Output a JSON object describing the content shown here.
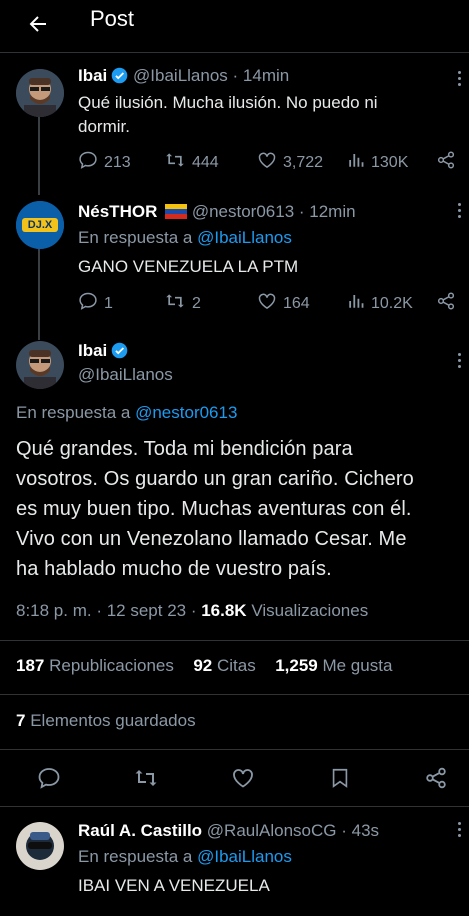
{
  "header": {
    "title": "Post"
  },
  "tweets": [
    {
      "name": "Ibai",
      "handle": "@IbaiLlanos",
      "time": "· 14min",
      "text_line1": "Qué ilusión. Mucha ilusión. No puedo ni",
      "text_line2": "dormir.",
      "replies": "213",
      "retweets": "444",
      "likes": "3,722",
      "views": "130K"
    },
    {
      "name": "NésTHOR",
      "handle": "@nestor0613",
      "time": "· 12min",
      "reply_prefix": "En respuesta a",
      "reply_to": "@IbaiLlanos",
      "text": "GANO VENEZUELA LA PTM",
      "replies": "1",
      "retweets": "2",
      "likes": "164",
      "views": "10.2K",
      "avatar_text": "DJ.X"
    }
  ],
  "main": {
    "name": "Ibai",
    "handle": "@IbaiLlanos",
    "reply_prefix": "En respuesta a",
    "reply_to": "@nestor0613",
    "lines": [
      "Qué grandes. Toda mi bendición para",
      "vosotros. Os guardo un gran cariño. Cichero",
      "es muy buen tipo. Muchas aventuras con él.",
      "Vivo con un Venezolano llamado Cesar. Me",
      "ha hablado mucho de vuestro país."
    ],
    "timestamp": "8:18 p. m. · 12 sept 23 ·",
    "views_count": "16.8K",
    "views_label": "Visualizaciones",
    "reposts_count": "187",
    "reposts_label": "Republicaciones",
    "quotes_count": "92",
    "quotes_label": "Citas",
    "likes_count": "1,259",
    "likes_label": "Me gusta",
    "bookmarks_count": "7",
    "bookmarks_label": "Elementos guardados"
  },
  "reply": {
    "name": "Raúl A. Castillo",
    "handle": "@RaulAlonsoCG",
    "time": "· 43s",
    "reply_prefix": "En respuesta a",
    "reply_to": "@IbaiLlanos",
    "text": "IBAI VEN A VENEZUELA"
  },
  "colors": {
    "accent": "#1d9bf0",
    "muted": "#8b98a5",
    "bg": "#000000",
    "text": "#e7e9ea"
  }
}
